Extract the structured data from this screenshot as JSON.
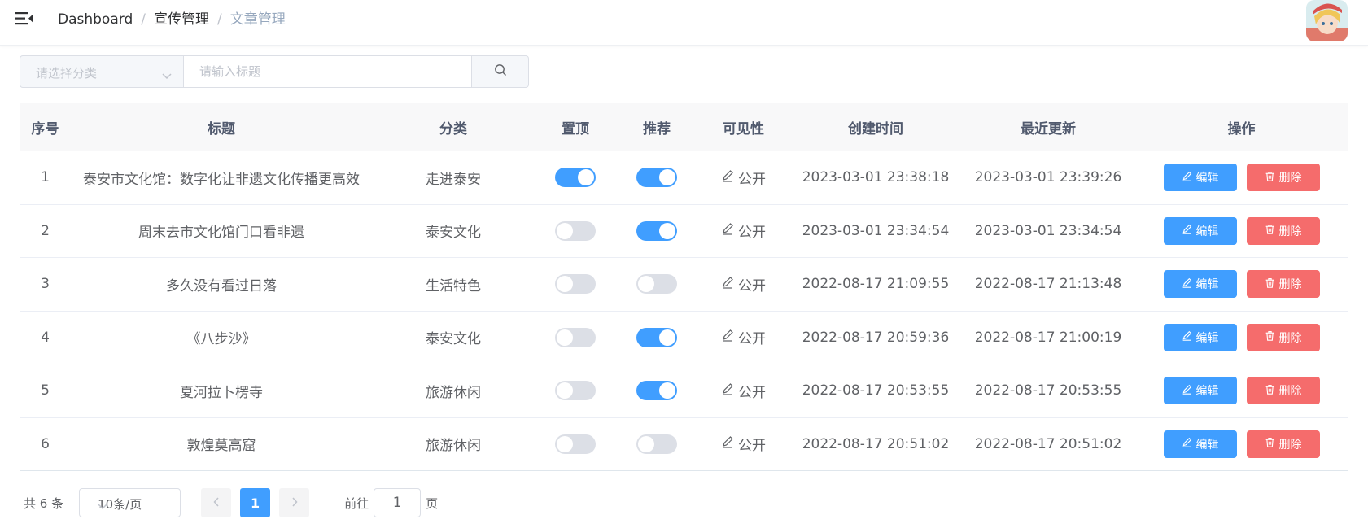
{
  "header": {
    "breadcrumb": [
      "Dashboard",
      "宣传管理",
      "文章管理"
    ],
    "separator": "/"
  },
  "filter": {
    "category_placeholder": "请选择分类",
    "title_placeholder": "请输入标题"
  },
  "table": {
    "columns": [
      "序号",
      "标题",
      "分类",
      "置顶",
      "推荐",
      "可见性",
      "创建时间",
      "最近更新",
      "操作"
    ],
    "rows": [
      {
        "index": "1",
        "title": "泰安市文化馆：数字化让非遗文化传播更高效",
        "category": "走进泰安",
        "pinned": true,
        "recommended": true,
        "visibility": "公开",
        "created": "2023-03-01 23:38:18",
        "updated": "2023-03-01 23:39:26"
      },
      {
        "index": "2",
        "title": "周末去市文化馆门口看非遗",
        "category": "泰安文化",
        "pinned": false,
        "recommended": true,
        "visibility": "公开",
        "created": "2023-03-01 23:34:54",
        "updated": "2023-03-01 23:34:54"
      },
      {
        "index": "3",
        "title": "多久没有看过日落",
        "category": "生活特色",
        "pinned": false,
        "recommended": false,
        "visibility": "公开",
        "created": "2022-08-17 21:09:55",
        "updated": "2022-08-17 21:13:48"
      },
      {
        "index": "4",
        "title": "《八步沙》",
        "category": "泰安文化",
        "pinned": false,
        "recommended": true,
        "visibility": "公开",
        "created": "2022-08-17 20:59:36",
        "updated": "2022-08-17 21:00:19"
      },
      {
        "index": "5",
        "title": "夏河拉卜楞寺",
        "category": "旅游休闲",
        "pinned": false,
        "recommended": true,
        "visibility": "公开",
        "created": "2022-08-17 20:53:55",
        "updated": "2022-08-17 20:53:55"
      },
      {
        "index": "6",
        "title": "敦煌莫高窟",
        "category": "旅游休闲",
        "pinned": false,
        "recommended": false,
        "visibility": "公开",
        "created": "2022-08-17 20:51:02",
        "updated": "2022-08-17 20:51:02"
      }
    ],
    "edit_label": "编辑",
    "delete_label": "删除"
  },
  "pagination": {
    "total": "共 6 条",
    "page_size": "10条/页",
    "current_page": "1",
    "goto_label": "前往",
    "goto_value": "1",
    "page_suffix": "页"
  },
  "colors": {
    "primary": "#409eff",
    "danger": "#f56c6c",
    "switch_off": "#dcdfe6"
  }
}
